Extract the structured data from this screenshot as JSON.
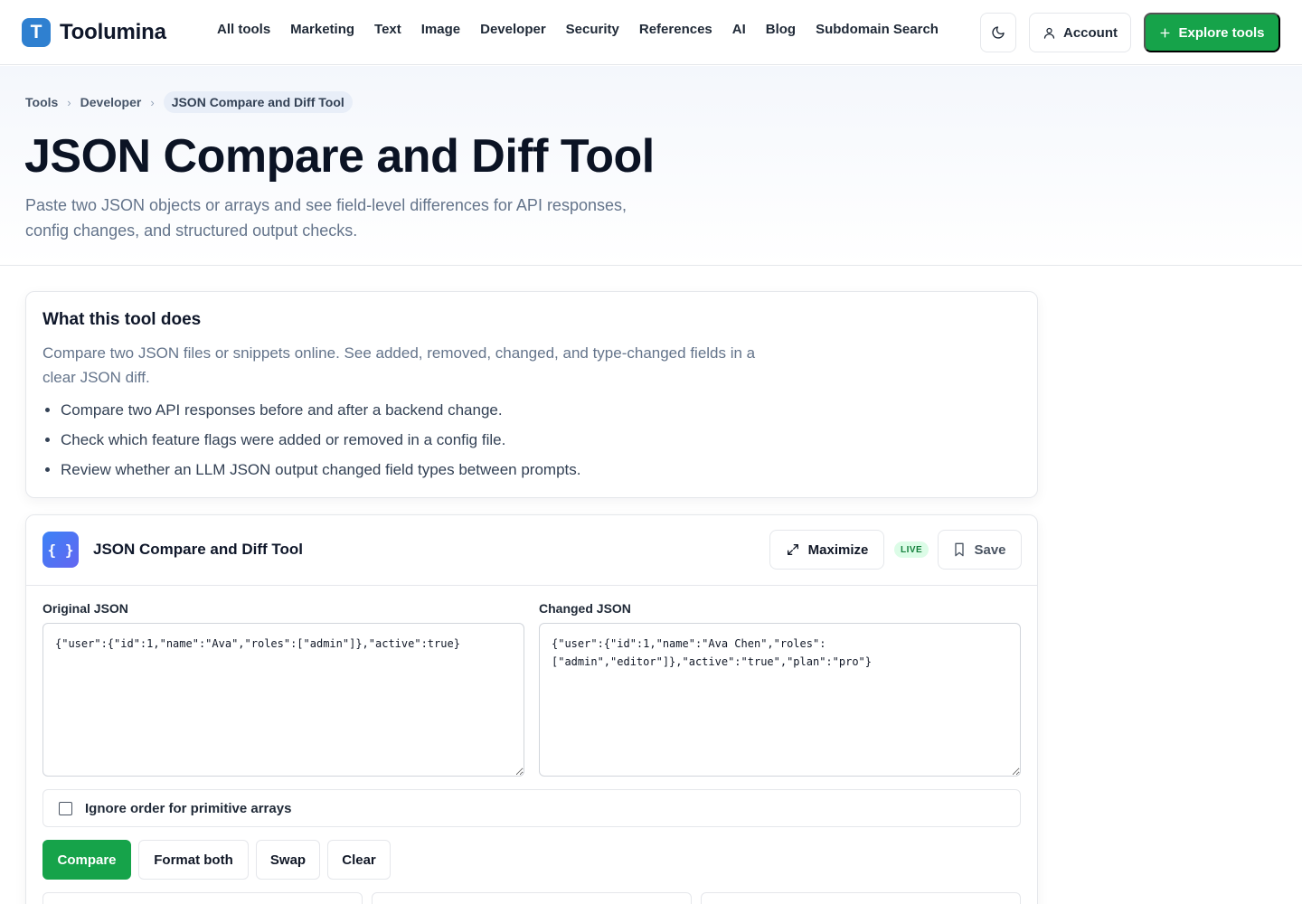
{
  "brand": {
    "name": "Toolumina",
    "logo_letter": "T"
  },
  "nav": {
    "items": [
      {
        "label": "All tools"
      },
      {
        "label": "Marketing"
      },
      {
        "label": "Text"
      },
      {
        "label": "Image"
      },
      {
        "label": "Developer"
      },
      {
        "label": "Security"
      },
      {
        "label": "References"
      },
      {
        "label": "AI"
      },
      {
        "label": "Blog"
      },
      {
        "label": "Subdomain Search"
      }
    ]
  },
  "header_actions": {
    "theme_icon": "moon-icon",
    "account_label": "Account",
    "account_icon": "user-icon",
    "explore_label": "Explore tools",
    "explore_icon": "plus-icon"
  },
  "breadcrumb": {
    "items": [
      "Tools",
      "Developer"
    ],
    "current": "JSON Compare and Diff Tool"
  },
  "page": {
    "title": "JSON Compare and Diff Tool",
    "subtitle": "Paste two JSON objects or arrays and see field-level differences for API responses, config changes, and structured output checks."
  },
  "about": {
    "title": "What this tool does",
    "description": "Compare two JSON files or snippets online. See added, removed, changed, and type-changed fields in a clear JSON diff.",
    "bullets": [
      "Compare two API responses before and after a backend change.",
      "Check which feature flags were added or removed in a config file.",
      "Review whether an LLM JSON output changed field types between prompts."
    ]
  },
  "tool": {
    "icon_glyph": "{ }",
    "name": "JSON Compare and Diff Tool",
    "maximize_label": "Maximize",
    "live_badge": "LIVE",
    "save_label": "Save",
    "original_label": "Original JSON",
    "original_value": "{\"user\":{\"id\":1,\"name\":\"Ava\",\"roles\":[\"admin\"]},\"active\":true}",
    "changed_label": "Changed JSON",
    "changed_value": "{\"user\":{\"id\":1,\"name\":\"Ava Chen\",\"roles\":\n[\"admin\",\"editor\"]},\"active\":\"true\",\"plan\":\"pro\"}",
    "ignore_order_label": "Ignore order for primitive arrays",
    "ignore_order_checked": false,
    "buttons": {
      "compare": "Compare",
      "format_both": "Format both",
      "swap": "Swap",
      "clear": "Clear"
    }
  },
  "colors": {
    "accent_green": "#16a34a",
    "brand_blue": "#2f80d0",
    "live_badge_bg": "#dcfce7"
  }
}
